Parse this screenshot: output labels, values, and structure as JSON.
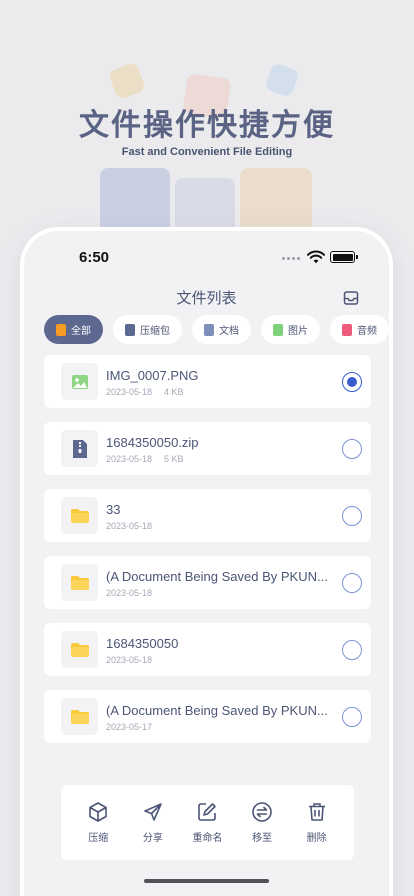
{
  "promo": {
    "title": "文件操作快捷方便",
    "subtitle": "Fast and Convenient File Editing"
  },
  "status_bar": {
    "time": "6:50"
  },
  "nav": {
    "title": "文件列表",
    "right_icon": "inbox-icon"
  },
  "categories": [
    {
      "label": "全部",
      "active": true,
      "icon": "file-orange-icon",
      "color": "#f59a23"
    },
    {
      "label": "压缩包",
      "active": false,
      "icon": "zip-icon",
      "color": "#5d6890"
    },
    {
      "label": "文档",
      "active": false,
      "icon": "doc-icon",
      "color": "#7d8fb8"
    },
    {
      "label": "图片",
      "active": false,
      "icon": "image-icon",
      "color": "#7fd17a"
    },
    {
      "label": "音频",
      "active": false,
      "icon": "music-icon",
      "color": "#ef5b7c"
    }
  ],
  "files": [
    {
      "name": "IMG_0007.PNG",
      "date": "2023-05-18",
      "size": "4 KB",
      "type": "image",
      "selected": true
    },
    {
      "name": "1684350050.zip",
      "date": "2023-05-18",
      "size": "5 KB",
      "type": "zip",
      "selected": false
    },
    {
      "name": "33",
      "date": "2023-05-18",
      "size": "",
      "type": "folder",
      "selected": false
    },
    {
      "name": "(A Document Being Saved By PKUN...",
      "date": "2023-05-18",
      "size": "",
      "type": "folder",
      "selected": false
    },
    {
      "name": "1684350050",
      "date": "2023-05-18",
      "size": "",
      "type": "folder",
      "selected": false
    },
    {
      "name": "(A Document Being Saved By PKUN...",
      "date": "2023-05-17",
      "size": "",
      "type": "folder",
      "selected": false
    }
  ],
  "toolbar": {
    "compress": "压缩",
    "share": "分享",
    "rename": "重命名",
    "move": "移至",
    "delete": "删除"
  },
  "colors": {
    "accent": "#3a5ccf",
    "active_chip": "#5d6890",
    "folder": "#f8c93a"
  }
}
